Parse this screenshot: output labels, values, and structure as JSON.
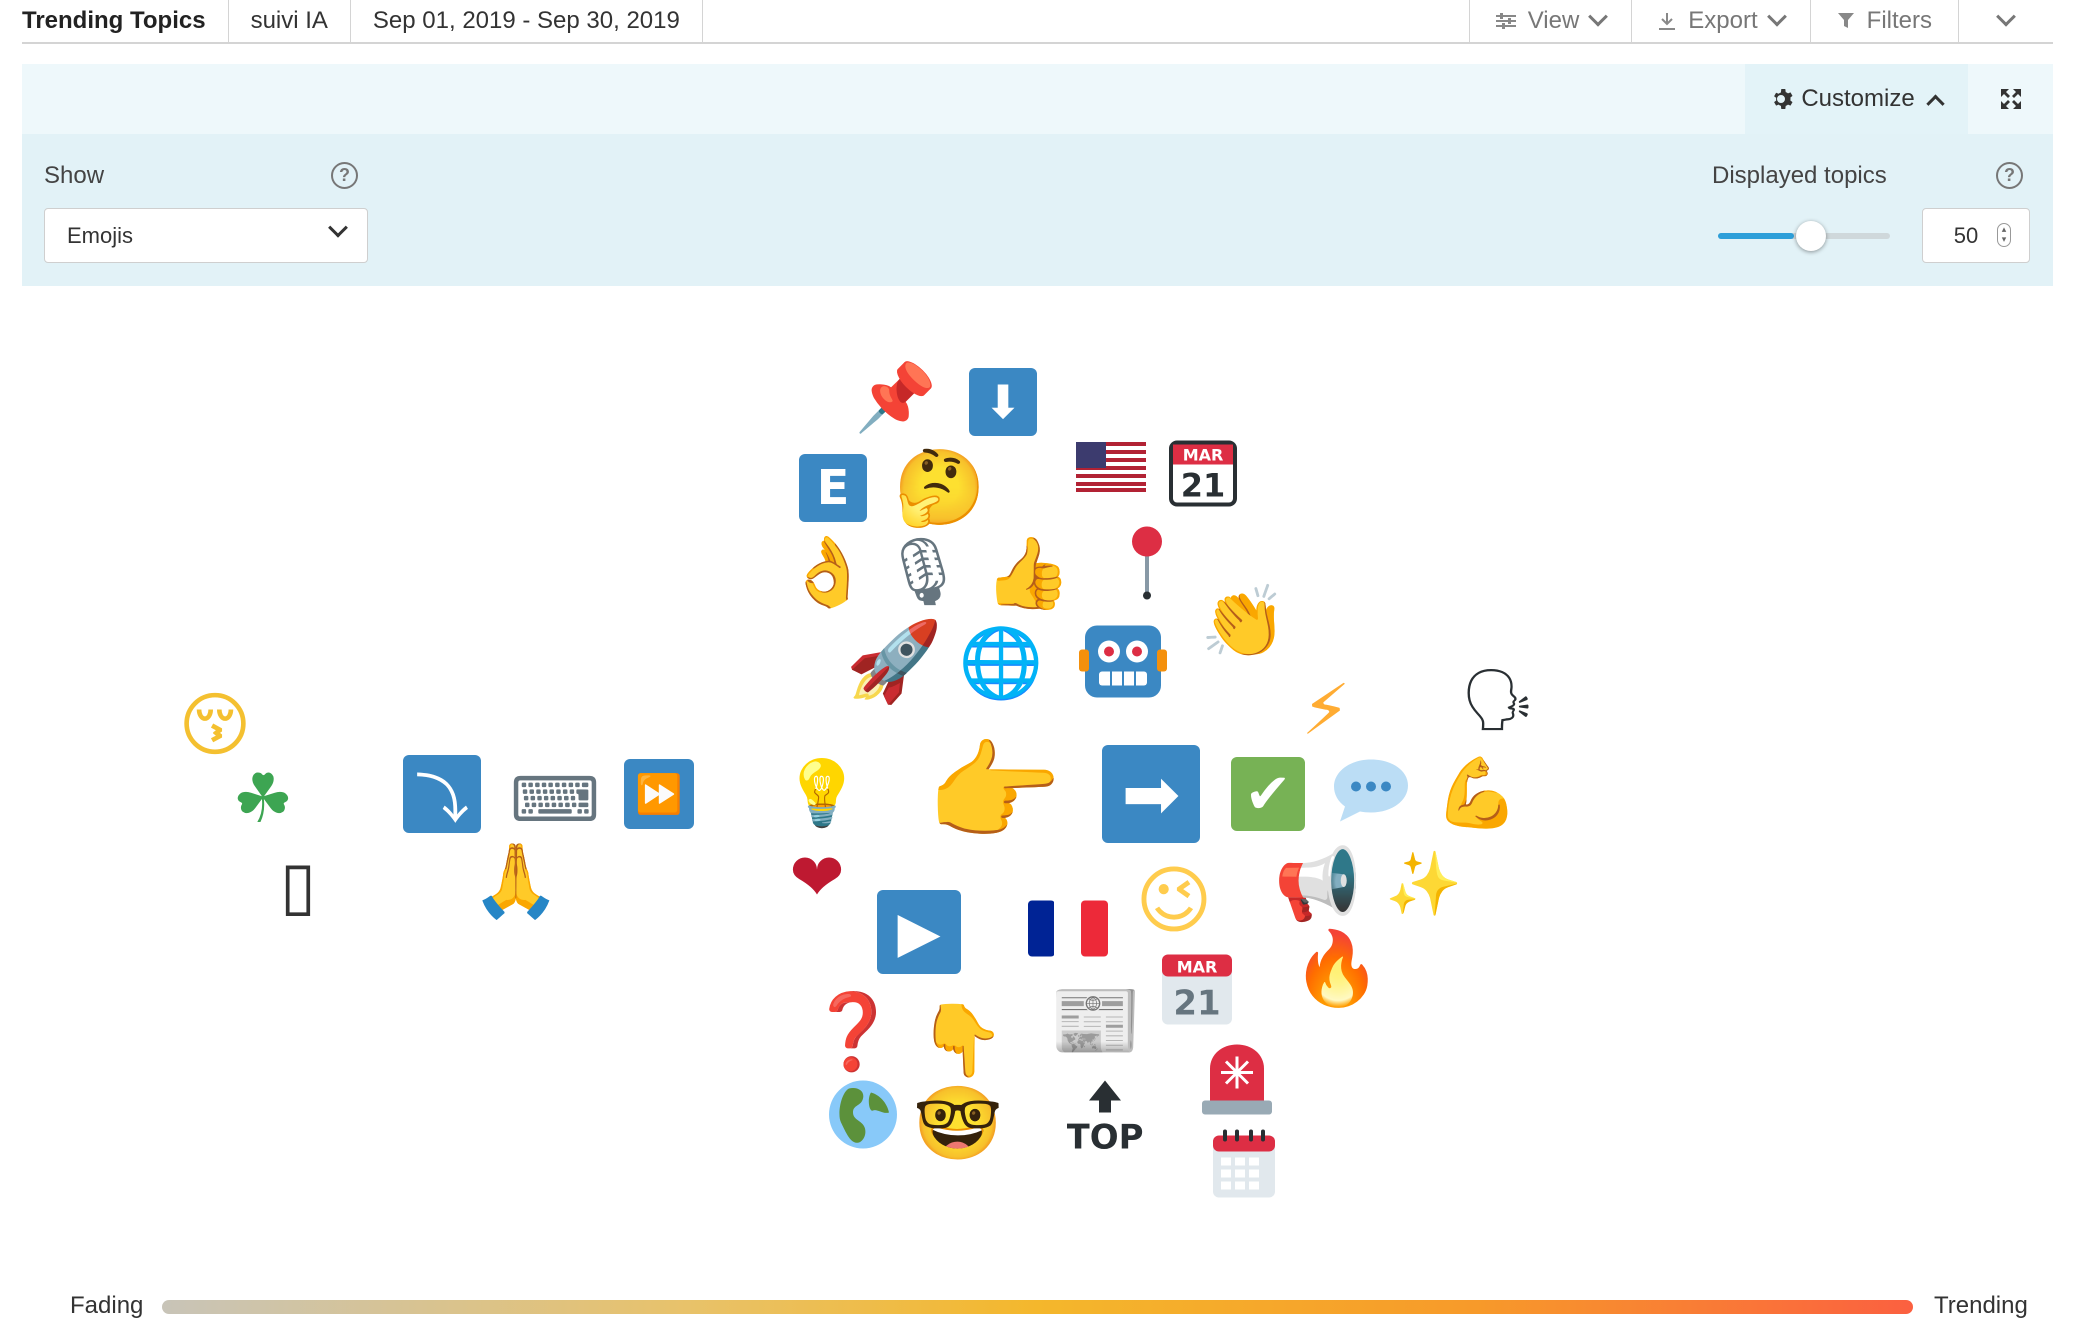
{
  "toolbar": {
    "title": "Trending Topics",
    "project": "suivi IA",
    "date_range": "Sep 01, 2019 - Sep 30, 2019",
    "view_label": "View",
    "export_label": "Export",
    "filters_label": "Filters"
  },
  "customize": {
    "label": "Customize"
  },
  "settings": {
    "show_label": "Show",
    "show_value": "Emojis",
    "displayed_topics_label": "Displayed topics",
    "displayed_topics_value": "50",
    "slider_fraction": 0.44,
    "accent_color": "#2d9fd9"
  },
  "cloud": {
    "emojis": [
      "kissing-face-blushing",
      "four-leaf-clover",
      "mobile-phone",
      "right-arrow-curving-down",
      "laptop",
      "folded-hands",
      "fast-forward-button",
      "pushpin",
      "down-arrow",
      "letter-e",
      "thinking-face",
      "ok-hand",
      "microphone",
      "thumbs-up",
      "flag-usa",
      "calendar-march-21",
      "round-pushpin",
      "clapping-hands",
      "rocket",
      "globe-meridians",
      "robot",
      "high-voltage",
      "speaking-head",
      "light-bulb",
      "backhand-index-pointing-right",
      "right-arrow",
      "check-mark-button",
      "speech-balloon",
      "flexed-biceps",
      "red-heart",
      "play-button",
      "flag-france",
      "winking-face",
      "megaphone",
      "sparkles",
      "tear-off-calendar-21",
      "fire",
      "question-mark",
      "backhand-index-pointing-down",
      "newspaper",
      "police-light",
      "globe-europe-africa",
      "nerd-face",
      "top-arrow",
      "spiral-calendar"
    ]
  },
  "legend": {
    "left_label": "Fading",
    "right_label": "Trending",
    "gradient_start": "#c8c4b8",
    "gradient_end": "#fb6040"
  }
}
